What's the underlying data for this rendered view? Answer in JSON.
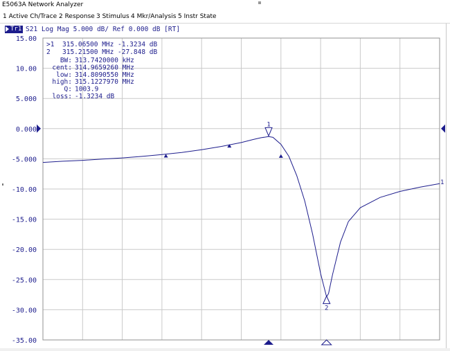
{
  "window": {
    "title": "E5063A Network Analyzer"
  },
  "menu": [
    {
      "label": "1 Active Ch/Trace"
    },
    {
      "label": "2 Response"
    },
    {
      "label": "3 Stimulus"
    },
    {
      "label": "4 Mkr/Analysis"
    },
    {
      "label": "5 Instr State"
    }
  ],
  "trace": {
    "badge": "Tr1",
    "settings": "S21 Log Mag 5.000 dB/ Ref 0.000 dB [RT]",
    "color": "#1c1c8c"
  },
  "markers": {
    "readout": [
      {
        "id": ">1",
        "freq": "315.06500 MHz",
        "value": "-1.3234 dB"
      },
      {
        "id": " 2",
        "freq": "315.21500 MHz",
        "value": "-27.848 dB"
      }
    ],
    "points": [
      {
        "label": "1",
        "x_fraction": 0.569,
        "value_db": -1.3234
      },
      {
        "label": "2",
        "x_fraction": 0.715,
        "value_db": -27.848
      }
    ]
  },
  "bandwidth": {
    "rows": [
      {
        "label": "BW:",
        "value": "313.7420000 kHz"
      },
      {
        "label": "cent:",
        "value": "314.9659260 MHz"
      },
      {
        "label": "low:",
        "value": "314.8090550 MHz"
      },
      {
        "label": "high:",
        "value": "315.1227970 MHz"
      },
      {
        "label": "Q:",
        "value": "1003.9"
      },
      {
        "label": "loss:",
        "value": "-1.3234 dB"
      }
    ]
  },
  "chart_data": {
    "type": "line",
    "title": "",
    "xlabel": "",
    "ylabel": "",
    "ylim": [
      -35,
      15
    ],
    "y_ticks": [
      "15.00",
      "10.00",
      "5.000",
      "0.000",
      "-5.000",
      "-10.00",
      "-15.00",
      "-20.00",
      "-25.00",
      "-30.00",
      "-35.00"
    ],
    "grid": true,
    "series": [
      {
        "name": "",
        "color": "#1c1c8c",
        "x": [
          0,
          0.05,
          0.1,
          0.15,
          0.2,
          0.25,
          0.3,
          0.35,
          0.4,
          0.45,
          0.5,
          0.53,
          0.55,
          0.569,
          0.58,
          0.6,
          0.62,
          0.64,
          0.66,
          0.68,
          0.7,
          0.715,
          0.72,
          0.73,
          0.75,
          0.77,
          0.8,
          0.85,
          0.9,
          0.95,
          1.0
        ],
        "y": [
          -5.6,
          -5.4,
          -5.25,
          -5.05,
          -4.85,
          -4.6,
          -4.3,
          -3.95,
          -3.5,
          -2.95,
          -2.3,
          -1.8,
          -1.5,
          -1.32,
          -1.45,
          -2.6,
          -4.6,
          -7.8,
          -12.0,
          -17.5,
          -24.0,
          -27.85,
          -27.3,
          -24.2,
          -18.8,
          -15.4,
          -13.1,
          -11.4,
          -10.4,
          -9.7,
          -9.1
        ]
      }
    ]
  }
}
